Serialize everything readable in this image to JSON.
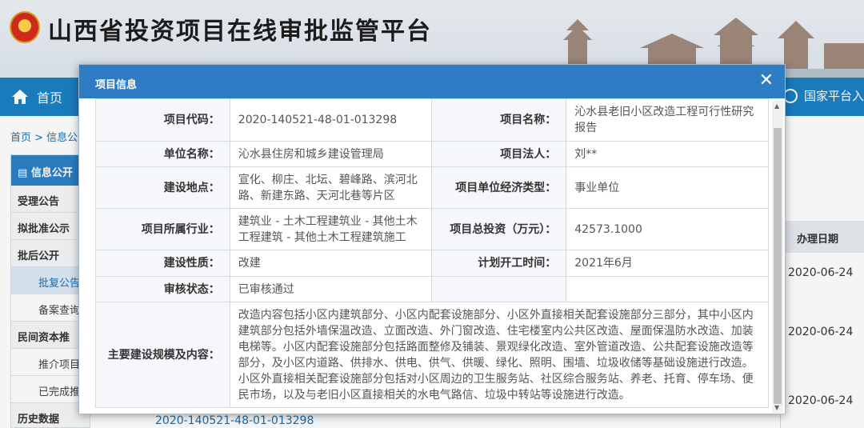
{
  "site": {
    "title": "山西省投资项目在线审批监管平台",
    "nav_home": "首页",
    "nav_right": "国家平台入"
  },
  "breadcrumb": "首页 > 信息公",
  "sidebar": {
    "header": "信息公开",
    "items": [
      {
        "label": "受理公告",
        "type": "top"
      },
      {
        "label": "拟批准公示",
        "type": "top"
      },
      {
        "label": "批后公开",
        "type": "top"
      },
      {
        "label": "批复公告",
        "type": "sub-active"
      },
      {
        "label": "备案查询",
        "type": "sub"
      },
      {
        "label": "民间资本推",
        "type": "top"
      },
      {
        "label": "推介项目",
        "type": "sub"
      },
      {
        "label": "已完成推",
        "type": "sub"
      },
      {
        "label": "历史数据",
        "type": "top"
      }
    ]
  },
  "background_table": {
    "date_header": "办理日期",
    "dates": [
      "2020-06-24",
      "2020-06-24",
      "2020-06-24"
    ],
    "bottom_code": "2020-140521-48-01-013298"
  },
  "modal": {
    "title": "项目信息",
    "close_symbol": "✕",
    "rows": [
      {
        "l1": "项目代码：",
        "v1": "2020-140521-48-01-013298",
        "l2": "项目名称：",
        "v2": "沁水县老旧小区改造工程可行性研究报告"
      },
      {
        "l1": "单位名称：",
        "v1": "沁水县住房和城乡建设管理局",
        "l2": "项目法人：",
        "v2": "刘**"
      },
      {
        "l1": "建设地点：",
        "v1": "宣化、柳庄、北坛、碧峰路、滨河北路、新建东路、天河北巷等片区",
        "l2": "项目单位经济类型：",
        "v2": "事业单位"
      },
      {
        "l1": "项目所属行业：",
        "v1": "建筑业 - 土木工程建筑业 - 其他土木工程建筑 - 其他土木工程建筑施工",
        "l2": "项目总投资（万元）：",
        "v2": "42573.1000"
      },
      {
        "l1": "建设性质：",
        "v1": "改建",
        "l2": "计划开工时间：",
        "v2": "2021年6月"
      },
      {
        "l1": "审核状态：",
        "v1": "已审核通过",
        "l2": "",
        "v2": ""
      }
    ],
    "scope_label": "主要建设规模及内容：",
    "scope_text": "改造内容包括小区内建筑部分、小区内配套设施部分、小区外直接相关配套设施部分三部分，其中小区内建筑部分包括外墙保温改造、立面改造、外门窗改造、住宅楼室内公共区改造、屋面保温防水改造、加装电梯等。小区内配套设施部分包括路面整修及铺装、景观绿化改造、室外管道改造、公共配套设施改造等部分，及小区内道路、供排水、供电、供气、供暖、绿化、照明、围墙、垃圾收储等基础设施进行改造。小区外直接相关配套设施部分包括对小区周边的卫生服务站、社区综合服务站、养老、托育、停车场、便民市场，以及与老旧小区直接相关的水电气路信、垃圾中转站等设施进行改造。"
  }
}
